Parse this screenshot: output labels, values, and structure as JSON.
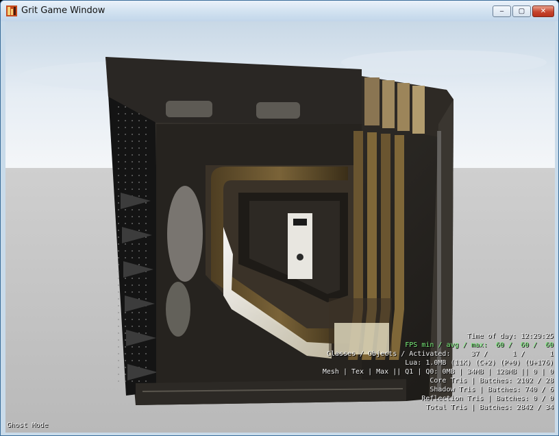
{
  "window": {
    "title": "Grit Game Window",
    "buttons": {
      "minimize": "‒",
      "maximize": "▢",
      "close": "✕"
    }
  },
  "hud": {
    "time_of_day": "Time of day: 12:29:25",
    "fps": "FPS min / avg / max:  60 /  60 /  60",
    "objects": "Classes / Objects / Activated:     37 /      1 /      1",
    "lua": "Lua: 1.0MB (11K) (C+2) (P+0) (U+176)",
    "memory": "Mesh | Tex | Max || Q1 | Q0: 0MB | 34MB | 128MB || 0 | 0",
    "core_tris": "Core Tris | Batches: 2102 / 28",
    "shadow_tris": "Shadow Tris | Batches: 740 / 6",
    "reflection_tris": "Reflection Tris | Batches: 0 / 0",
    "total_tris": "Total Tris | Batches: 2842 / 34",
    "mode": "Ghost Mode"
  },
  "colors": {
    "hud_text": "#f2f2f2",
    "fps_text": "#7cf27c",
    "sky": "#c9dbea",
    "ground": "#c4c4c4"
  }
}
